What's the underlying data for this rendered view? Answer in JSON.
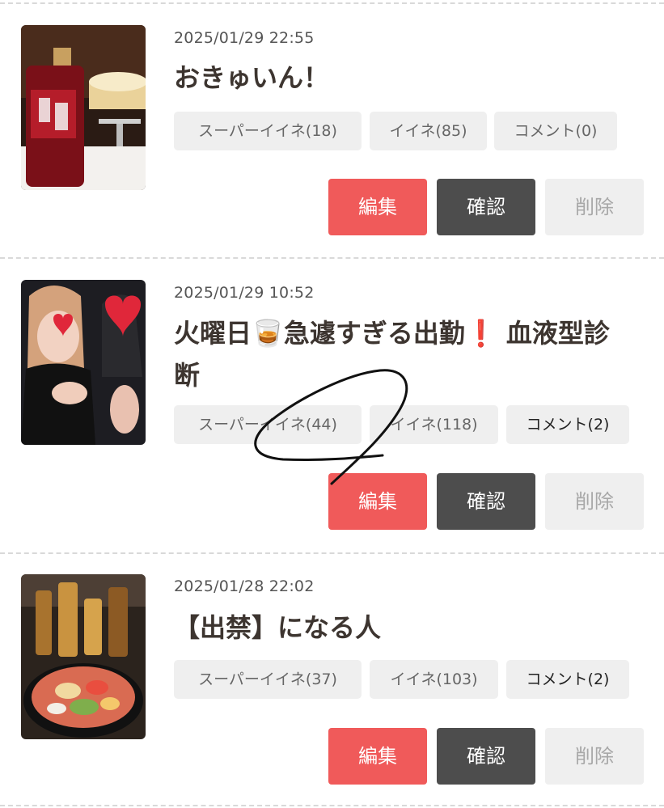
{
  "colors": {
    "edit_button": "#f05a5a",
    "confirm_button": "#4d4d4d",
    "delete_button": "#efefef",
    "tag_background": "#efefef",
    "divider": "#d9d9d9"
  },
  "posts": [
    {
      "date": "2025/01/29 22:55",
      "title": "おきゅいん！",
      "tags": {
        "super_like": "スーパーイイネ(18)",
        "like": "イイネ(85)",
        "comment": "コメント(0)"
      },
      "buttons": {
        "edit": "編集",
        "confirm": "確認",
        "delete": "削除"
      },
      "image_alt": "bottle and cheesecake photo"
    },
    {
      "date": "2025/01/29 10:52",
      "title": "火曜日🥃急遽すぎる出勤❗ 血液型診断",
      "tags": {
        "super_like": "スーパーイイネ(44)",
        "like": "イイネ(118)",
        "comment": "コメント(2)"
      },
      "buttons": {
        "edit": "編集",
        "confirm": "確認",
        "delete": "削除"
      },
      "image_alt": "selfie with heart stickers"
    },
    {
      "date": "2025/01/28 22:02",
      "title": "【出禁】になる人",
      "tags": {
        "super_like": "スーパーイイネ(37)",
        "like": "イイネ(103)",
        "comment": "コメント(2)"
      },
      "buttons": {
        "edit": "編集",
        "confirm": "確認",
        "delete": "削除"
      },
      "image_alt": "bottles and sushi platter photo"
    }
  ]
}
